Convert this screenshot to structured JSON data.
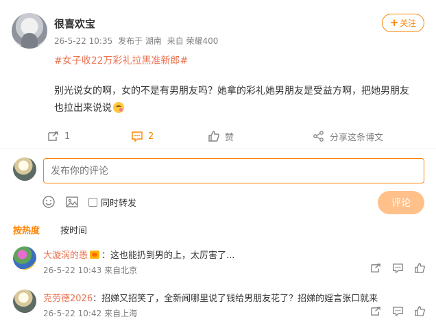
{
  "post": {
    "author": "很喜欢宝",
    "meta": {
      "time": "26-5-22 10:35",
      "location": "发布于 湖南",
      "source": "来自 荣耀400"
    },
    "follow_label": "关注",
    "follow_plus": "+",
    "topic": "#女子收22万彩礼拉黑准新郎#",
    "text": "别光说女的啊，女的不是有男朋友吗？她拿的彩礼她男朋友是受益方啊，把她男朋友也拉出来说说"
  },
  "actions": {
    "repost_count": "1",
    "comment_count": "2",
    "like_label": "赞",
    "share_label": "分享这条博文"
  },
  "comment_box": {
    "placeholder": "发布你的评论",
    "repost_label": "同时转发",
    "submit_label": "评论"
  },
  "sort_tabs": {
    "hot": "按热度",
    "time": "按时间"
  },
  "comments": [
    {
      "user": "大漩涡的愚",
      "text": "：这也能扔到男的上，太厉害了...",
      "time": "26-5-22 10:43",
      "location": "来自北京"
    },
    {
      "user": "克劳德2026",
      "text": "：招娣又招笑了，全新闻哪里说了钱给男朋友花了？招娣的婬言张口就来",
      "time": "26-5-22 10:42",
      "location": "来自上海"
    }
  ],
  "colors": {
    "accent": "#ff8200",
    "topic": "#eb7350",
    "muted": "#808080",
    "submit_disabled": "#ffc08a"
  }
}
